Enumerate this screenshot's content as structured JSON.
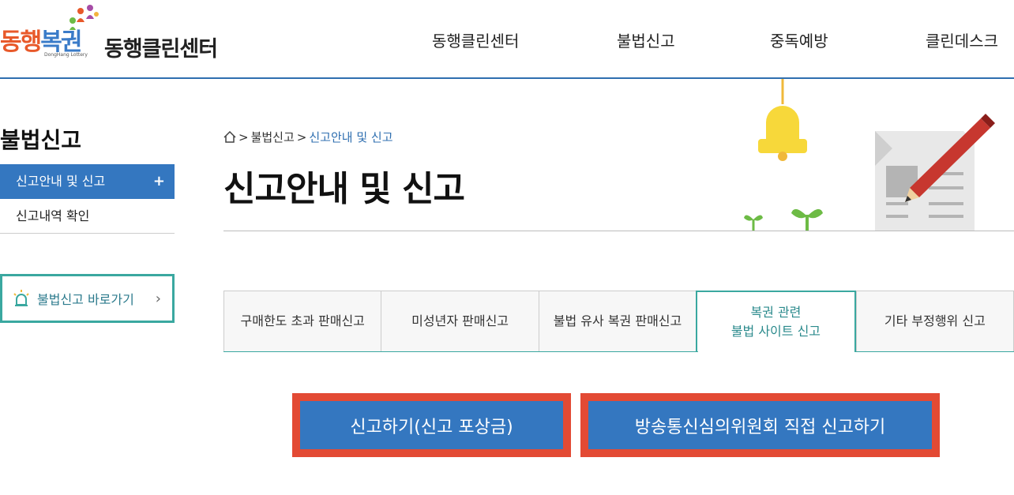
{
  "header": {
    "logo_chars": [
      "동",
      "행",
      "복",
      "권"
    ],
    "logo_sub": "DongHang Lottery",
    "site_title": "동행클린센터",
    "nav": [
      "동행클린센터",
      "불법신고",
      "중독예방",
      "클린데스크"
    ]
  },
  "sidebar": {
    "title": "불법신고",
    "items": [
      {
        "label": "신고안내 및 신고",
        "active": true
      },
      {
        "label": "신고내역 확인",
        "active": false
      }
    ],
    "quick_link": "불법신고 바로가기"
  },
  "breadcrumb": {
    "items": [
      "불법신고",
      "신고안내 및 신고"
    ],
    "separator": ">"
  },
  "page_title": "신고안내 및 신고",
  "tabs": [
    {
      "line1": "구매한도 초과 판매신고",
      "line2": "",
      "active": false
    },
    {
      "line1": "미성년자 판매신고",
      "line2": "",
      "active": false
    },
    {
      "line1": "불법 유사 복권 판매신고",
      "line2": "",
      "active": false
    },
    {
      "line1": "복권 관련",
      "line2": "불법 사이트 신고",
      "active": true
    },
    {
      "line1": "기타 부정행위 신고",
      "line2": "",
      "active": false
    }
  ],
  "actions": {
    "report_button": "신고하기(신고 포상금)",
    "kcsc_button": "방송통신심의위원회 직접 신고하기"
  },
  "colors": {
    "primary_blue": "#3477c0",
    "teal": "#3aa8a0",
    "highlight_red": "#e34a34"
  }
}
